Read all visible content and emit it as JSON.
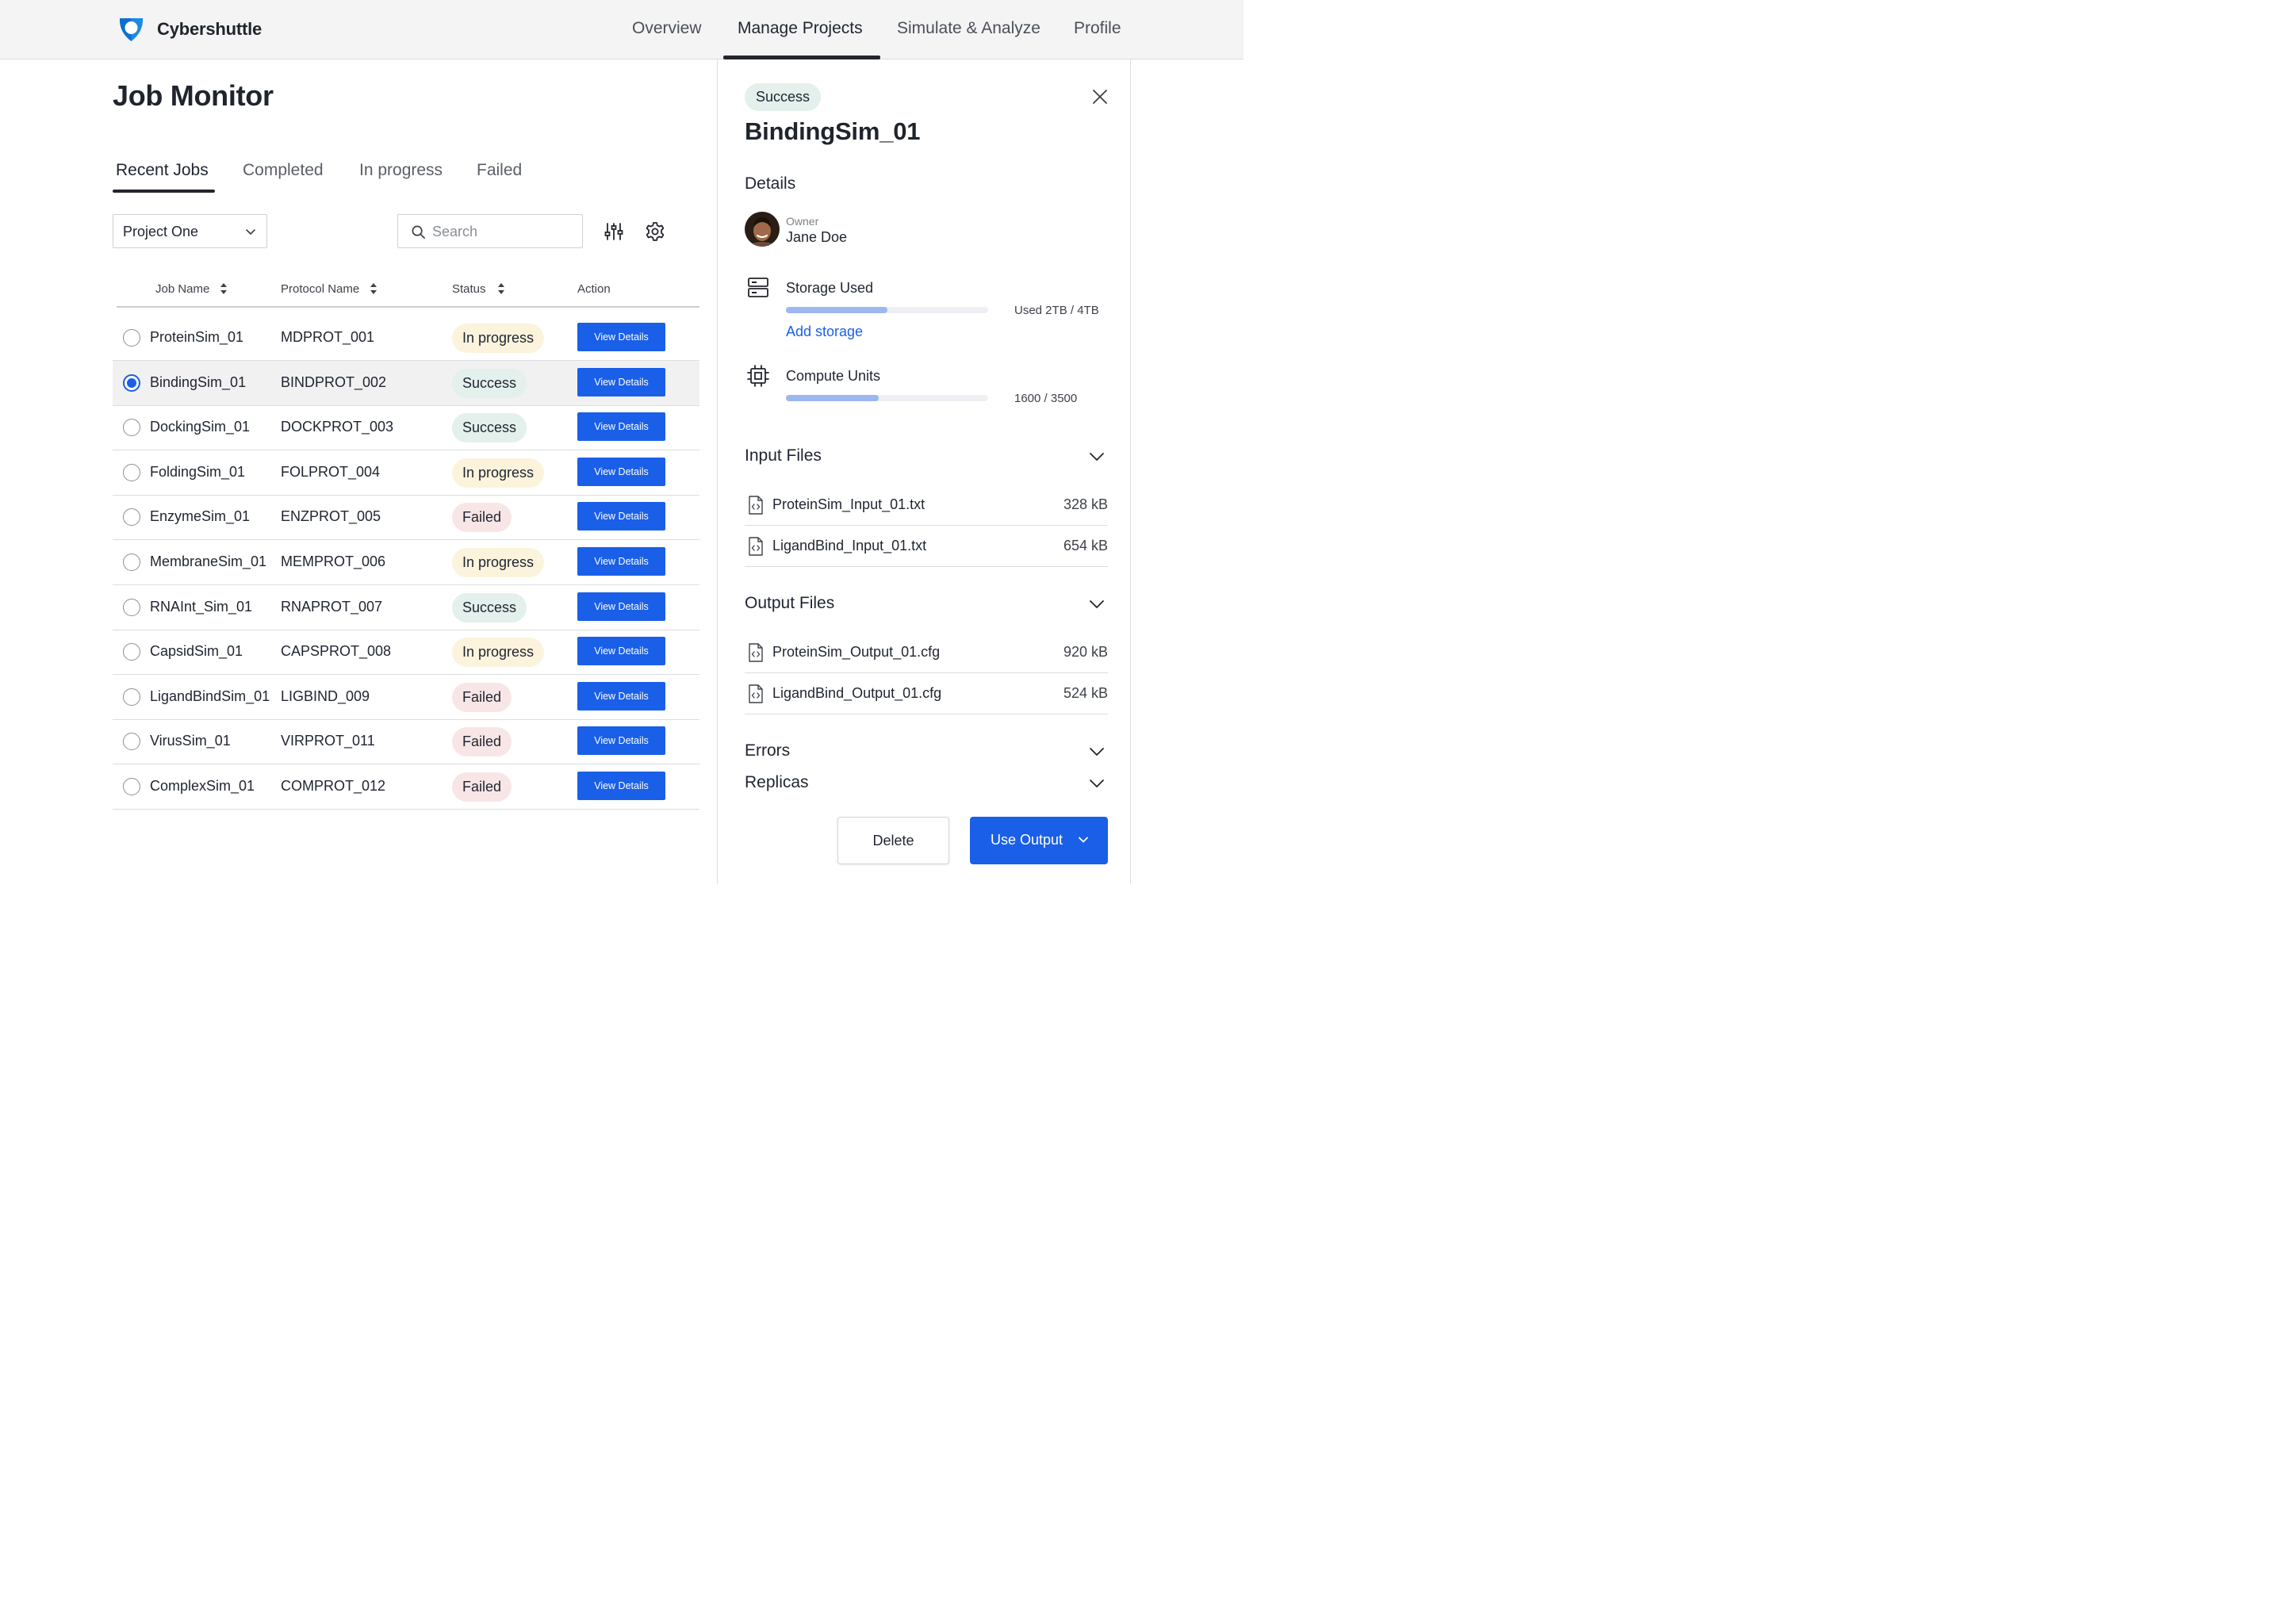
{
  "app": {
    "brand": "Cybershuttle",
    "nav": [
      "Overview",
      "Manage Projects",
      "Simulate & Analyze",
      "Profile"
    ],
    "active_nav": "Manage Projects"
  },
  "job_monitor": {
    "title": "Job Monitor",
    "tabs": [
      "Recent Jobs",
      "Completed",
      "In progress",
      "Failed"
    ],
    "active_tab": "Recent Jobs",
    "project_select": "Project One",
    "search_placeholder": "Search",
    "columns": [
      "Job Name",
      "Protocol Name",
      "Status",
      "Action"
    ],
    "action_label": "View Details",
    "selected_row": "BindingSim_01",
    "rows": [
      {
        "job": "ProteinSim_01",
        "protocol": "MDPROT_001",
        "status": "In progress"
      },
      {
        "job": "BindingSim_01",
        "protocol": "BINDPROT_002",
        "status": "Success"
      },
      {
        "job": "DockingSim_01",
        "protocol": "DOCKPROT_003",
        "status": "Success"
      },
      {
        "job": "FoldingSim_01",
        "protocol": "FOLPROT_004",
        "status": "In progress"
      },
      {
        "job": "EnzymeSim_01",
        "protocol": "ENZPROT_005",
        "status": "Failed"
      },
      {
        "job": "MembraneSim_01",
        "protocol": "MEMPROT_006",
        "status": "In progress"
      },
      {
        "job": "RNAInt_Sim_01",
        "protocol": "RNAPROT_007",
        "status": "Success"
      },
      {
        "job": "CapsidSim_01",
        "protocol": "CAPSPROT_008",
        "status": "In progress"
      },
      {
        "job": "LigandBindSim_01",
        "protocol": "LIGBIND_009",
        "status": "Failed"
      },
      {
        "job": "VirusSim_01",
        "protocol": "VIRPROT_011",
        "status": "Failed"
      },
      {
        "job": "ComplexSim_01",
        "protocol": "COMPROT_012",
        "status": "Failed"
      }
    ]
  },
  "detail": {
    "status": "Success",
    "title": "BindingSim_01",
    "details_heading": "Details",
    "owner_label": "Owner",
    "owner_name": "Jane Doe",
    "storage_label": "Storage Used",
    "storage_value": "Used 2TB / 4TB",
    "storage_fraction": 0.5,
    "add_storage": "Add storage",
    "compute_label": "Compute Units",
    "compute_value": "1600 / 3500",
    "compute_fraction": 0.457,
    "input_heading": "Input Files",
    "input_files": [
      {
        "name": "ProteinSim_Input_01.txt",
        "size": "328 kB"
      },
      {
        "name": "LigandBind_Input_01.txt",
        "size": "654 kB"
      }
    ],
    "output_heading": "Output Files",
    "output_files": [
      {
        "name": "ProteinSim_Output_01.cfg",
        "size": "920 kB"
      },
      {
        "name": "LigandBind_Output_01.cfg",
        "size": "524 kB"
      }
    ],
    "errors_heading": "Errors",
    "replicas_heading": "Replicas",
    "delete_label": "Delete",
    "use_output_label": "Use Output"
  },
  "icons": {
    "logo": "cybershuttle-logo-icon",
    "filter": "sliders-icon",
    "settings": "gear-icon",
    "search": "search-icon",
    "close": "close-icon",
    "storage": "server-icon",
    "compute": "cpu-chip-icon",
    "file": "code-file-icon",
    "expand": "chevron-down-icon"
  },
  "colors": {
    "primary": "#1a5fe8",
    "success_bg": "#e3f0ec",
    "progress_bg": "#fbf3dc",
    "failed_bg": "#f8e6e6",
    "bar_fill": "#9db7f0"
  }
}
